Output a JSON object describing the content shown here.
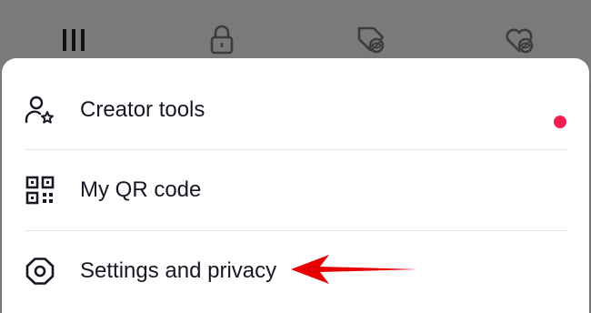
{
  "top_tabs": [
    {
      "icon": "grid-icon"
    },
    {
      "icon": "lock-icon"
    },
    {
      "icon": "hidden-tag-icon"
    },
    {
      "icon": "hidden-heart-icon"
    }
  ],
  "menu": {
    "items": [
      {
        "label": "Creator tools",
        "icon": "user-star-icon",
        "has_notification": true
      },
      {
        "label": "My QR code",
        "icon": "qr-code-icon",
        "has_notification": false
      },
      {
        "label": "Settings and privacy",
        "icon": "gear-icon",
        "has_notification": false
      }
    ]
  },
  "colors": {
    "notification_dot": "#ee1d52",
    "annotation_arrow": "#e60000",
    "backdrop": "#767676",
    "sheet": "#ffffff",
    "label_text": "#161823"
  },
  "annotation": {
    "type": "arrow",
    "target": "Settings and privacy"
  }
}
